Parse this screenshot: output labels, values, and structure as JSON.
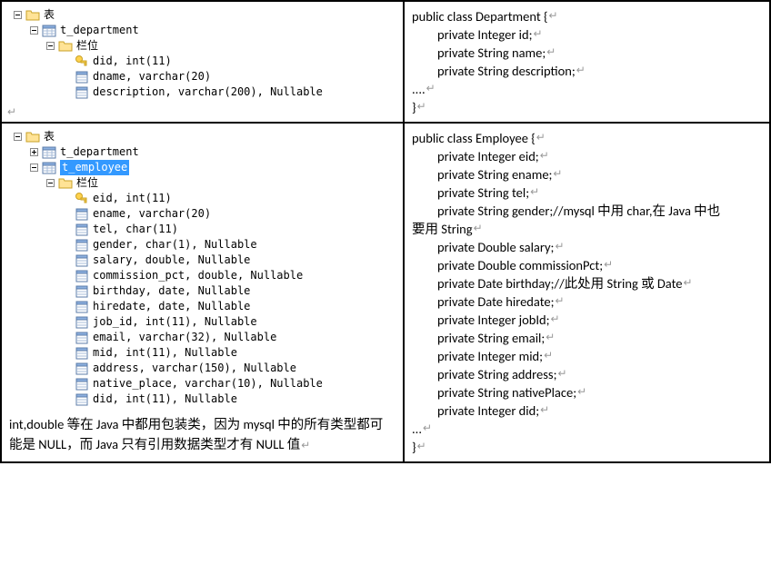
{
  "top_left": {
    "root": "表",
    "table": "t_department",
    "columns_label": "栏位",
    "columns": [
      "did, int(11)",
      "dname, varchar(20)",
      "description, varchar(200), Nullable"
    ]
  },
  "bottom_left": {
    "root": "表",
    "table1": "t_department",
    "table2": "t_employee",
    "columns_label": "栏位",
    "columns": [
      "eid, int(11)",
      "ename, varchar(20)",
      "tel, char(11)",
      "gender, char(1), Nullable",
      "salary, double, Nullable",
      "commission_pct, double, Nullable",
      "birthday, date, Nullable",
      "hiredate, date, Nullable",
      "job_id, int(11), Nullable",
      "email, varchar(32), Nullable",
      "mid, int(11), Nullable",
      "address, varchar(150), Nullable",
      "native_place, varchar(10), Nullable",
      "did, int(11), Nullable"
    ],
    "note": "int,double 等在 Java 中都用包装类，因为 mysql 中的所有类型都可能是 NULL，而 Java 只有引用数据类型才有 NULL 值"
  },
  "top_right": {
    "l0": "public class Department {",
    "l1": "private Integer id;",
    "l2": "private String name;",
    "l3": "private String description;",
    "l4": "....",
    "l5": "}"
  },
  "bottom_right": {
    "l0": "public class Employee {",
    "l1": "private Integer eid;",
    "l2": "private String ename;",
    "l3": "private String tel;",
    "l4a": "private String gender;//mysql 中用 char,在 Java 中也",
    "l4b": "要用 String",
    "l5": "private Double salary;",
    "l6": "private Double commissionPct;",
    "l7": "private Date birthday;//此处用 String 或 Date",
    "l8": "private Date hiredate;",
    "l9": "private Integer jobId;",
    "l10": "private String email;",
    "l11": "private Integer mid;",
    "l12": "private String address;",
    "l13": "private String nativePlace;",
    "l14": "private Integer did;",
    "l15": "...",
    "l16": "}"
  },
  "glyph": {
    "return": "↵"
  }
}
